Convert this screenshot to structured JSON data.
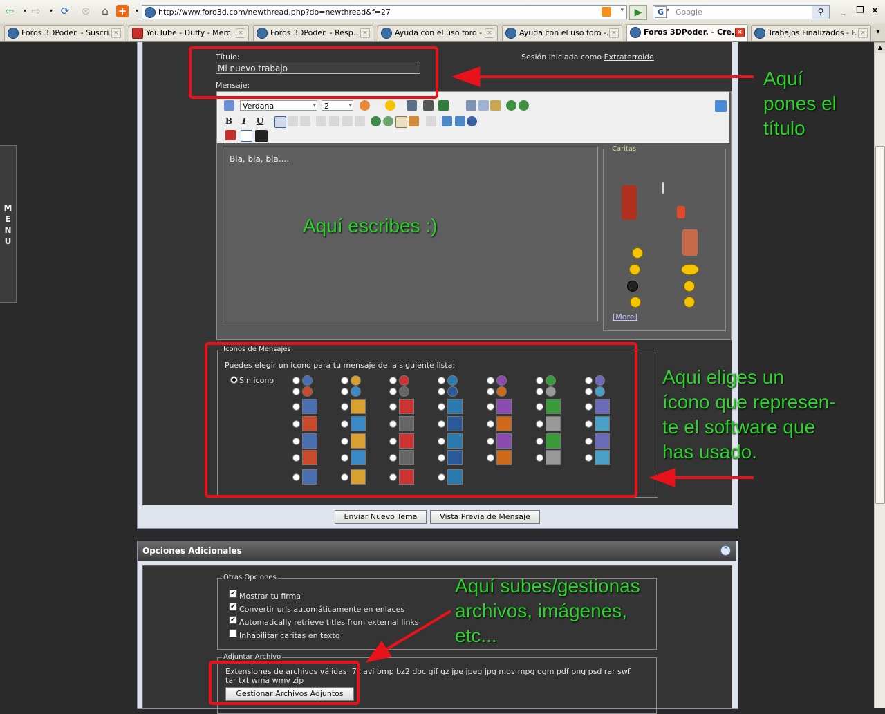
{
  "browser": {
    "url": "http://www.foro3d.com/newthread.php?do=newthread&f=27",
    "search_placeholder": "Google",
    "window_controls": [
      "_",
      "❐",
      "×"
    ],
    "tabs": [
      {
        "label": "Foros 3DPoder. - Suscri...",
        "icon": "site-favicon",
        "active": false
      },
      {
        "label": "YouTube - Duffy - Merc...",
        "icon": "youtube-favicon",
        "active": false
      },
      {
        "label": "Foros 3DPoder. - Resp...",
        "icon": "site-favicon",
        "active": false
      },
      {
        "label": "Ayuda con el uso foro -...",
        "icon": "site-favicon",
        "active": false
      },
      {
        "label": "Ayuda con el uso foro -...",
        "icon": "site-favicon",
        "active": false
      },
      {
        "label": "Foros 3DPoder. - Cre...",
        "icon": "site-favicon",
        "active": true
      },
      {
        "label": "Trabajos Finalizados - F...",
        "icon": "site-favicon",
        "active": false
      }
    ]
  },
  "side_menu": {
    "letters": [
      "M",
      "E",
      "N",
      "U"
    ]
  },
  "form": {
    "title_label": "Título:",
    "title_value": "Mi nuevo trabajo",
    "message_label": "Mensaje:",
    "session_text": "Sesión iniciada como",
    "session_user": "Extraterroide",
    "font_select": "Verdana",
    "size_select": "2",
    "format_buttons": [
      "B",
      "I",
      "U"
    ],
    "message_body": "Bla, bla, bla....",
    "smilies_legend": "Caritas",
    "smilies_more": "[More]"
  },
  "icons_section": {
    "legend": "Iconos de Mensajes",
    "help": "Puedes elegir un icono para tu mensaje de la siguiente lista:",
    "none_label": "Sin icono",
    "selected": "none"
  },
  "buttons": {
    "submit": "Enviar Nuevo Tema",
    "preview": "Vista Previa de Mensaje"
  },
  "additional": {
    "header": "Opciones Adicionales",
    "other_legend": "Otras Opciones",
    "options": [
      {
        "label": "Mostrar tu firma",
        "checked": true
      },
      {
        "label": "Convertir urls automáticamente en enlaces",
        "checked": true
      },
      {
        "label": "Automatically retrieve titles from external links",
        "checked": true
      },
      {
        "label": "Inhabilitar caritas en texto",
        "checked": false
      }
    ],
    "attach_legend": "Adjuntar Archivo",
    "extensions_line1": "Extensiones de archivos válidas: 7z avi bmp bz2 doc gif gz jpe jpeg jpg mov mpg ogm pdf png psd rar swf",
    "extensions_line2": "tar txt wma wmv zip",
    "manage_button": "Gestionar Archivos Adjuntos"
  },
  "annotations": {
    "title_note": [
      "Aquí",
      "pones el",
      "título"
    ],
    "write_note": "Aquí escribes :)",
    "icon_note": [
      "Aqui eliges un",
      "ícono que represen-",
      "te el software que",
      "has usado."
    ],
    "attach_note": [
      "Aquí subes/gestionas",
      "archivos, imágenes,",
      "etc..."
    ]
  },
  "colors": {
    "annotation_green": "#2fd12f",
    "annotation_red": "#e8121a",
    "panel_dark": "#343434"
  }
}
